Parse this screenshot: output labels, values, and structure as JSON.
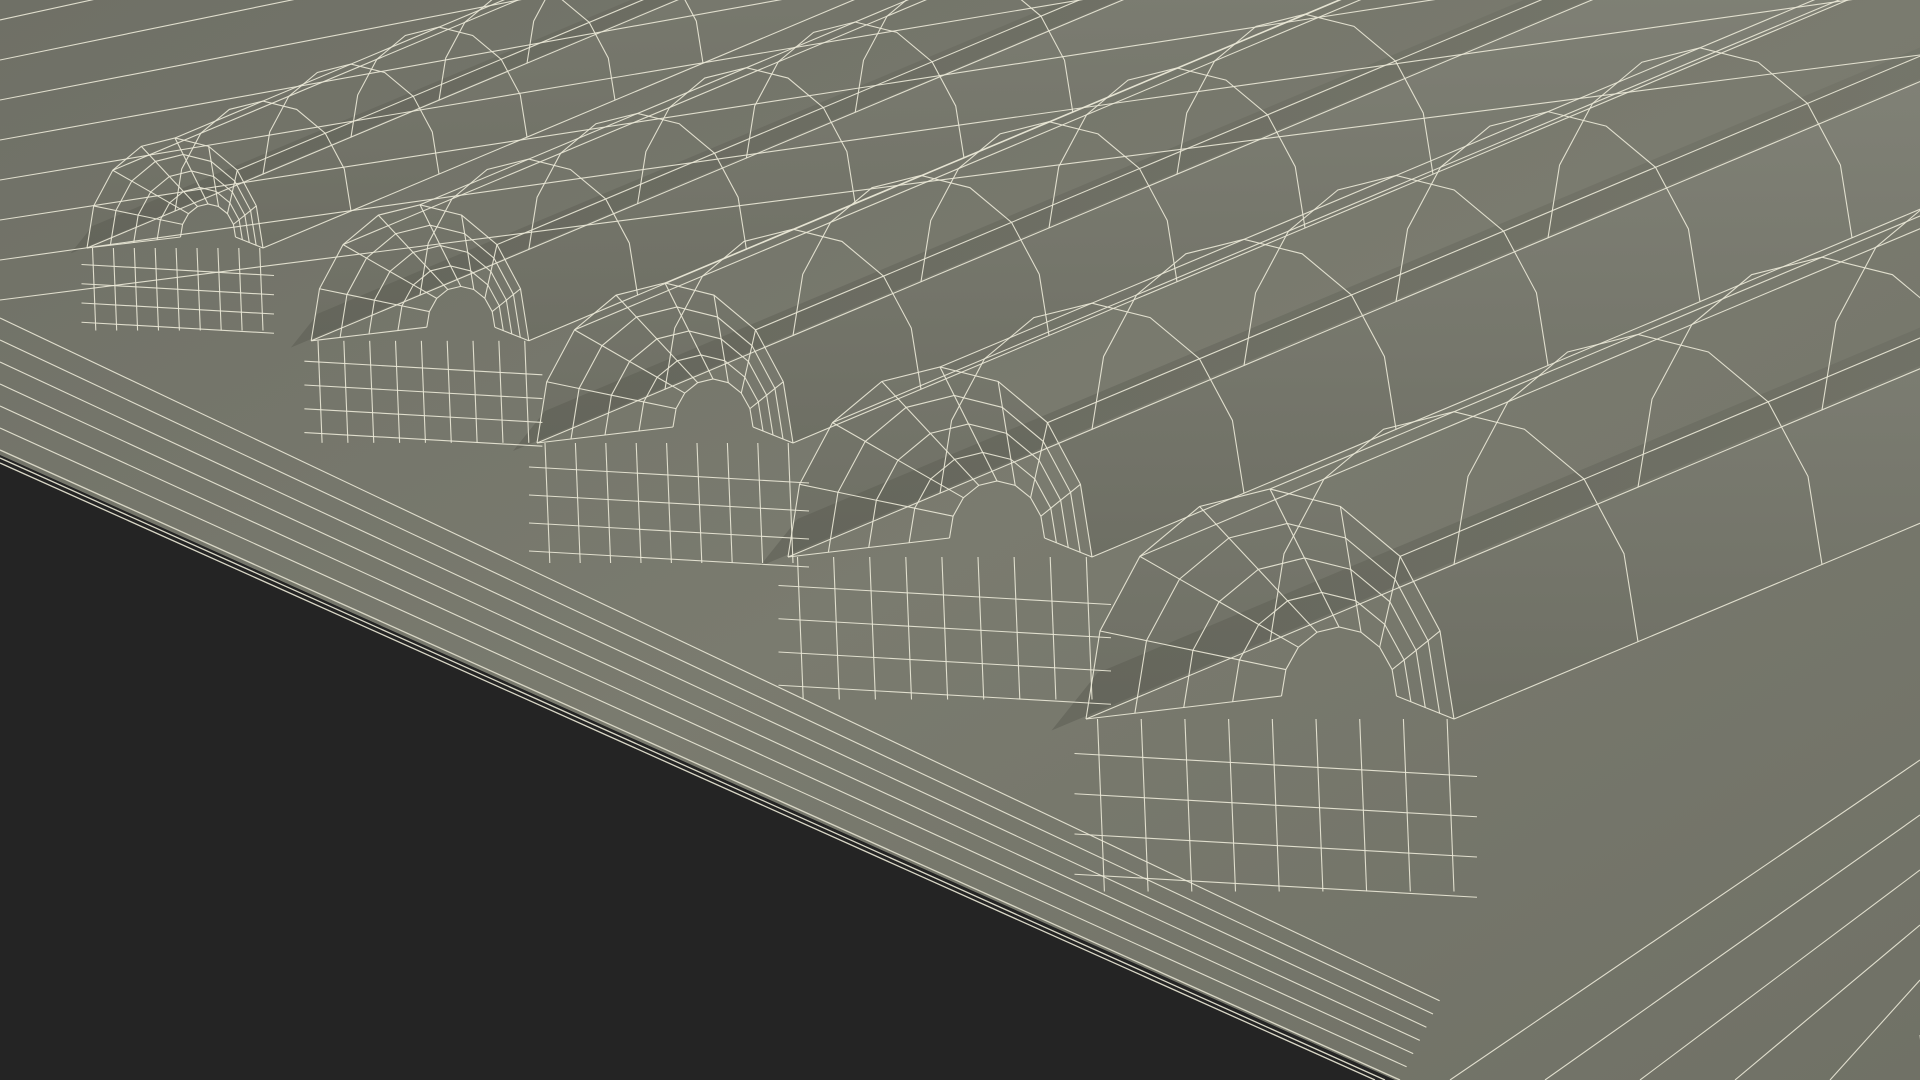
{
  "scene": {
    "subject": "wireframe-3d-mesh-render",
    "background_color": "#242424",
    "surface_color": "#797a6d",
    "surface_shadow_color": "#5e5f55",
    "surface_highlight_color": "#878879",
    "wire_color": "#e9e7d6"
  }
}
